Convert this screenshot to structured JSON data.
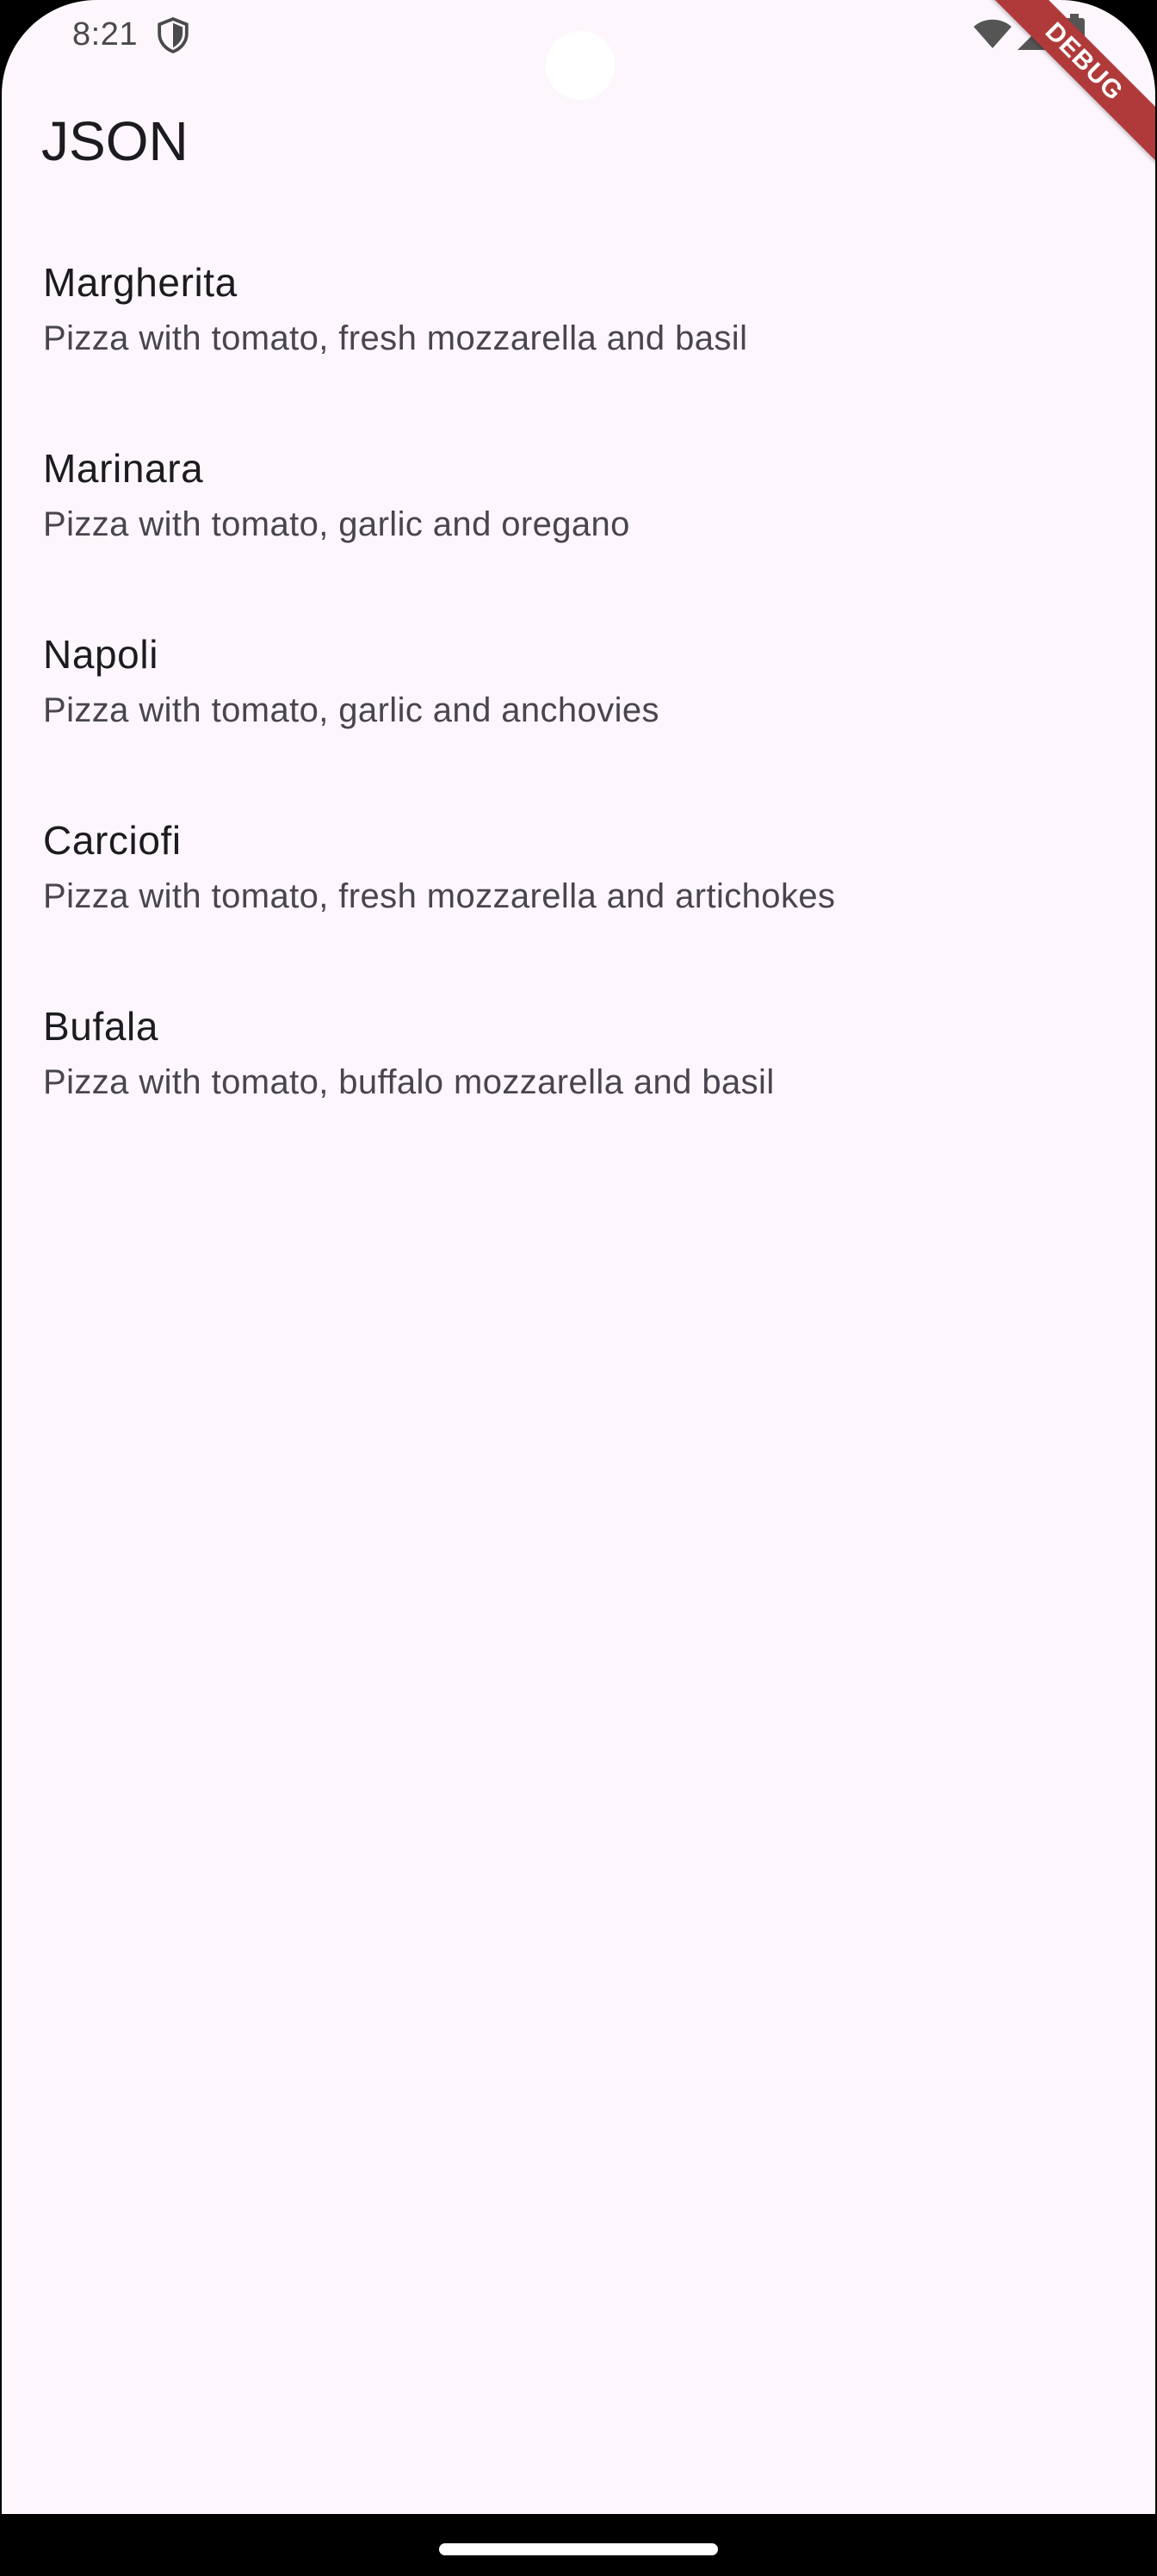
{
  "status_bar": {
    "time": "8:21",
    "icons": [
      "shield-icon",
      "wifi-icon",
      "signal-icon",
      "battery-icon"
    ]
  },
  "debug_banner": {
    "label": "DEBUG",
    "color": "#B03A3A"
  },
  "app_bar": {
    "title": "JSON"
  },
  "pizzas": [
    {
      "name": "Margherita",
      "description": "Pizza with tomato, fresh mozzarella and basil"
    },
    {
      "name": "Marinara",
      "description": "Pizza with tomato, garlic and oregano"
    },
    {
      "name": "Napoli",
      "description": "Pizza with tomato, garlic and anchovies"
    },
    {
      "name": "Carciofi",
      "description": "Pizza with tomato, fresh mozzarella and artichokes"
    },
    {
      "name": "Bufala",
      "description": "Pizza with tomato, buffalo mozzarella and basil"
    }
  ],
  "colors": {
    "background": "#FDF7FD",
    "title_text": "#1C1B1F",
    "subtitle_text": "#49454F"
  }
}
